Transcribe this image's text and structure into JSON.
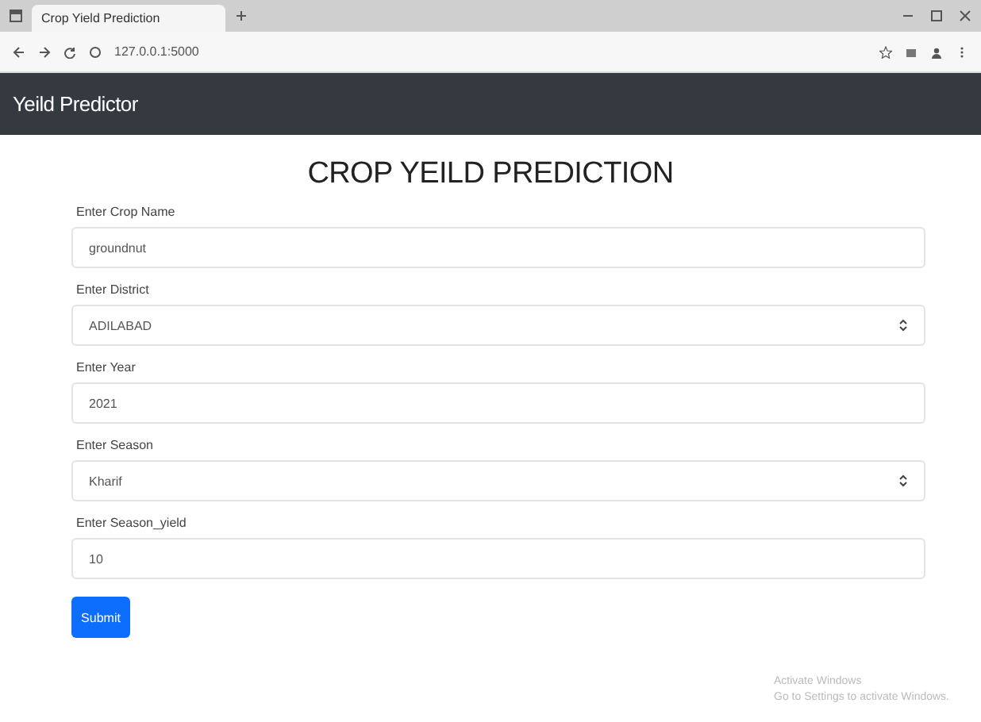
{
  "browser": {
    "tab_title": "Crop Yield Prediction",
    "address": "127.0.0.1:5000"
  },
  "navbar": {
    "brand": "Yeild Predictor"
  },
  "title": "CROP YEILD PREDICTION",
  "fields": [
    {
      "kind": "input",
      "label": "Enter Crop Name",
      "value": "groundnut"
    },
    {
      "kind": "select",
      "label": "Enter District",
      "value": "ADILABAD"
    },
    {
      "kind": "input",
      "label": "Enter Year",
      "value": "2021"
    },
    {
      "kind": "select",
      "label": "Enter Season",
      "value": "Kharif"
    },
    {
      "kind": "input",
      "label": "Enter Season_yield",
      "value": "10"
    }
  ],
  "submit": "Submit",
  "os_notice": {
    "title": "Activate Windows",
    "text": "Go to Settings to activate Windows."
  }
}
